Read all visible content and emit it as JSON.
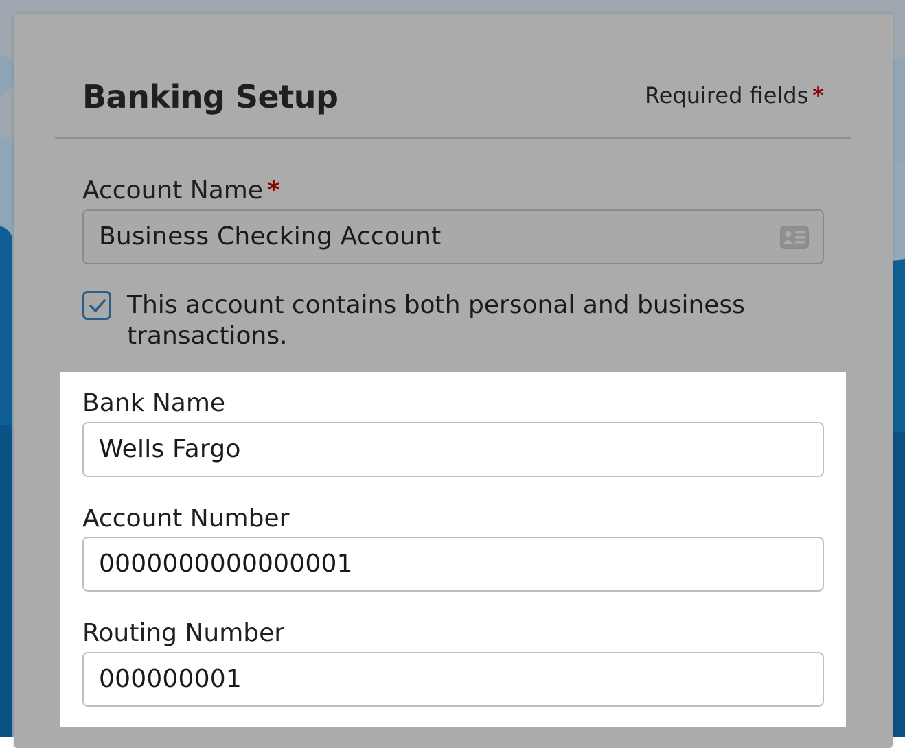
{
  "dialog": {
    "title": "Banking Setup",
    "required_note": "Required fields",
    "required_marker": "*"
  },
  "account_name": {
    "label": "Account Name",
    "required_marker": "*",
    "value": "Business Checking Account",
    "icon": "contact-card-icon"
  },
  "mixed_use": {
    "checked": true,
    "label": "This account contains both personal and business transactions."
  },
  "bank_name": {
    "label": "Bank Name",
    "value": "Wells Fargo"
  },
  "account_number": {
    "label": "Account Number",
    "value": "0000000000000001"
  },
  "routing_number": {
    "label": "Routing Number",
    "value": "000000001"
  },
  "colors": {
    "overlay": "#ababab",
    "highlight": "#ffffff",
    "required": "#8a0000",
    "checkbox_border": "#2b5d86",
    "background_blue": "#0f5f94"
  }
}
